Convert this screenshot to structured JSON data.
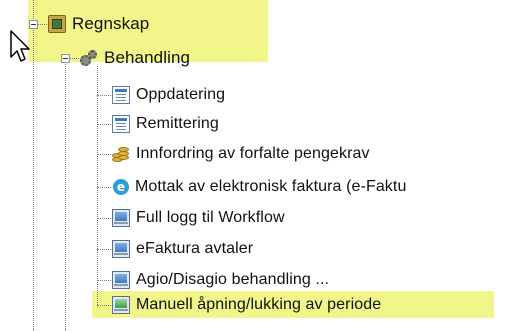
{
  "tree": {
    "root": {
      "label": "Regnskap",
      "icon": "registry-folder-icon"
    },
    "group": {
      "label": "Behandling",
      "icon": "gears-icon"
    },
    "items": [
      {
        "label": "Oppdatering",
        "icon": "document-icon"
      },
      {
        "label": "Remittering",
        "icon": "document-icon"
      },
      {
        "label": "Innfordring av forfalte pengekrav",
        "icon": "coins-icon"
      },
      {
        "label": "Mottak av elektronisk faktura (e-Faktu",
        "icon": "e-invoice-icon"
      },
      {
        "label": "Full logg til Workflow",
        "icon": "monitor-icon"
      },
      {
        "label": "eFaktura avtaler",
        "icon": "monitor-icon"
      },
      {
        "label": "Agio/Disagio behandling ...",
        "icon": "monitor-icon"
      },
      {
        "label": "Manuell åpning/lukking av periode",
        "icon": "monitor-icon"
      }
    ]
  },
  "colors": {
    "highlight": "#f2f58a",
    "tree_line": "#7a7a7a",
    "text": "#111111"
  }
}
